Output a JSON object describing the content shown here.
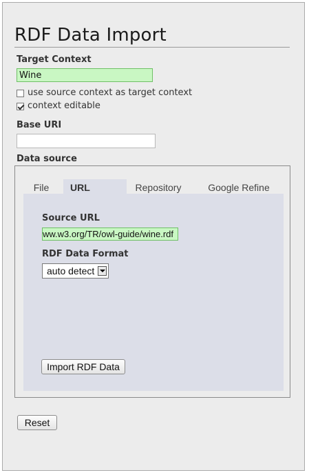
{
  "page": {
    "title": "RDF Data Import"
  },
  "target_context": {
    "label": "Target Context",
    "value": "Wine",
    "use_source_context": {
      "label": "use source context as target context",
      "checked": false
    },
    "context_editable": {
      "label": "context editable",
      "checked": true
    }
  },
  "base_uri": {
    "label": "Base URI",
    "value": ""
  },
  "data_source": {
    "label": "Data source",
    "tabs": [
      {
        "label": "File",
        "active": false
      },
      {
        "label": "URL",
        "active": true
      },
      {
        "label": "Repository",
        "active": false
      },
      {
        "label": "Google Refine",
        "active": false
      }
    ],
    "source_url": {
      "label": "Source URL",
      "value": "ww.w3.org/TR/owl-guide/wine.rdf"
    },
    "format": {
      "label": "RDF Data Format",
      "selected": "auto detect"
    },
    "import_button": "Import RDF Data"
  },
  "reset_button": "Reset",
  "colors": {
    "panel_bg": "#ececec",
    "tab_panel_bg": "#dcdee8",
    "valid_input_bg": "#c9f7c3"
  }
}
